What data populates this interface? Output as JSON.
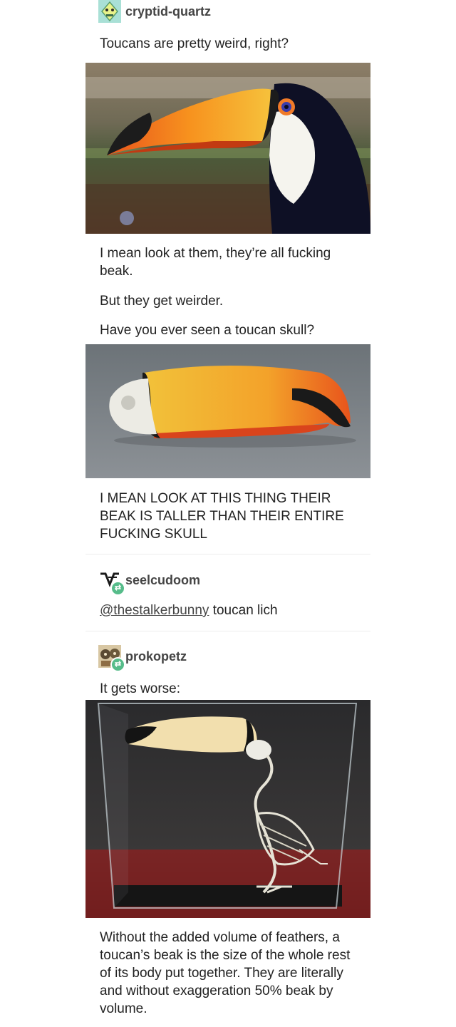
{
  "posts": {
    "op": {
      "username": "cryptid-quartz",
      "lines": [
        "Toucans are pretty weird, right?",
        "I mean look at them, they’re all fucking beak.",
        "But they get weirder.",
        "Have you ever seen a toucan skull?",
        "I MEAN LOOK AT THIS THING THEIR BEAK IS TALLER THAN THEIR ENTIRE FUCKING SKULL"
      ]
    },
    "reblog1": {
      "username": "seelcudoom",
      "mention": "@thestalkerbunny",
      "text": " toucan lich"
    },
    "reblog2": {
      "username": "prokopetz",
      "lead": "It gets worse:",
      "caption": "Without the added volume of feathers, a toucan’s beak is the size of the whole rest of its body put together. They are literally and without exaggeration 50% beak by volume."
    }
  },
  "colors": {
    "reblog_badge": "#56bc8a",
    "text": "#222222",
    "username": "#444444"
  },
  "icons": {
    "reblog": "retweet-arrows-icon"
  }
}
